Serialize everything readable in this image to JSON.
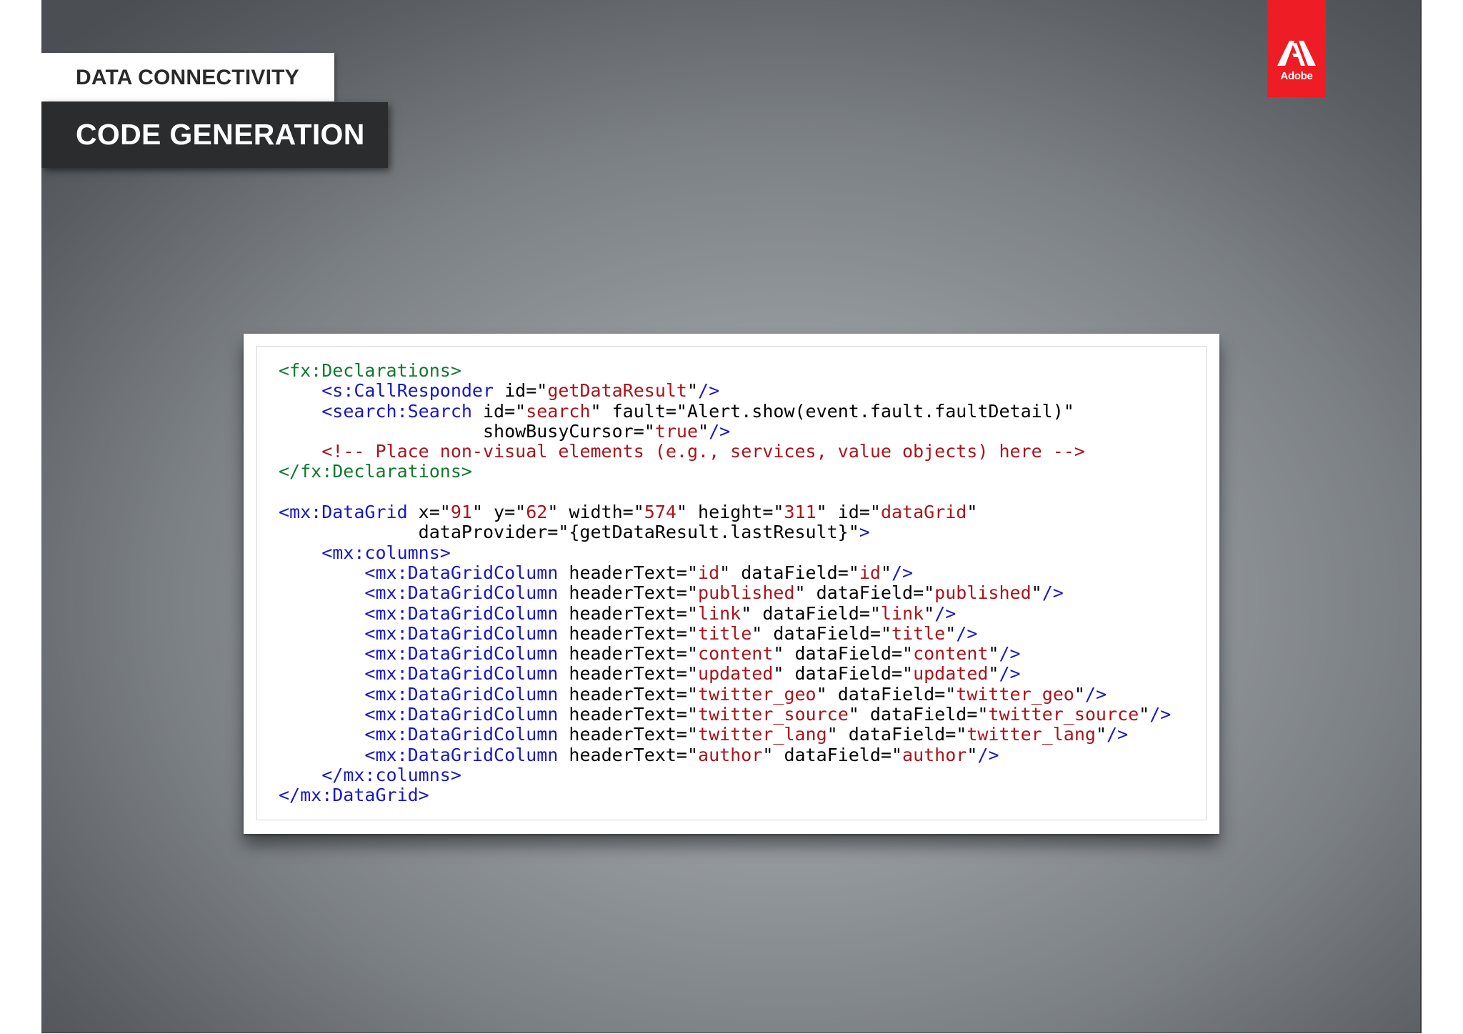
{
  "slide": {
    "section_label": "DATA CONNECTIVITY",
    "title": "CODE GENERATION",
    "logo_text": "Adobe"
  },
  "colors": {
    "tag_green": "#12792e",
    "tag_blue": "#1818c4",
    "string_red": "#a8151b",
    "adobe_red": "#ee1c24",
    "title_bar": "#2b2c2e"
  },
  "code": {
    "lines": [
      [
        {
          "t": "<fx:Declarations>",
          "c": "green"
        }
      ],
      [
        {
          "t": "    ",
          "c": "black"
        },
        {
          "t": "<s:CallResponder",
          "c": "blue"
        },
        {
          "t": " id=\"",
          "c": "black"
        },
        {
          "t": "getDataResult",
          "c": "red"
        },
        {
          "t": "\"",
          "c": "black"
        },
        {
          "t": "/>",
          "c": "blue"
        }
      ],
      [
        {
          "t": "    ",
          "c": "black"
        },
        {
          "t": "<search:Search",
          "c": "blue"
        },
        {
          "t": " id=\"",
          "c": "black"
        },
        {
          "t": "search",
          "c": "red"
        },
        {
          "t": "\" fault=\"Alert.show(event.fault.faultDetail)\"",
          "c": "black"
        }
      ],
      [
        {
          "t": "                   showBusyCursor=\"",
          "c": "black"
        },
        {
          "t": "true",
          "c": "red"
        },
        {
          "t": "\"",
          "c": "black"
        },
        {
          "t": "/>",
          "c": "blue"
        }
      ],
      [
        {
          "t": "    ",
          "c": "black"
        },
        {
          "t": "<!-- Place non-visual elements (e.g., services, value objects) here -->",
          "c": "comment"
        }
      ],
      [
        {
          "t": "</fx:Declarations>",
          "c": "green"
        }
      ],
      [
        {
          "t": "",
          "c": "black"
        }
      ],
      [
        {
          "t": "<mx:DataGrid",
          "c": "blue"
        },
        {
          "t": " x=\"",
          "c": "black"
        },
        {
          "t": "91",
          "c": "red"
        },
        {
          "t": "\" y=\"",
          "c": "black"
        },
        {
          "t": "62",
          "c": "red"
        },
        {
          "t": "\" width=\"",
          "c": "black"
        },
        {
          "t": "574",
          "c": "red"
        },
        {
          "t": "\" height=\"",
          "c": "black"
        },
        {
          "t": "311",
          "c": "red"
        },
        {
          "t": "\" id=\"",
          "c": "black"
        },
        {
          "t": "dataGrid",
          "c": "red"
        },
        {
          "t": "\"",
          "c": "black"
        }
      ],
      [
        {
          "t": "             dataProvider=\"{getDataResult.lastResult}\"",
          "c": "black"
        },
        {
          "t": ">",
          "c": "blue"
        }
      ],
      [
        {
          "t": "    ",
          "c": "black"
        },
        {
          "t": "<mx:columns>",
          "c": "blue"
        }
      ],
      [
        {
          "t": "        ",
          "c": "black"
        },
        {
          "t": "<mx:DataGridColumn",
          "c": "blue"
        },
        {
          "t": " headerText=\"",
          "c": "black"
        },
        {
          "t": "id",
          "c": "red"
        },
        {
          "t": "\" dataField=\"",
          "c": "black"
        },
        {
          "t": "id",
          "c": "red"
        },
        {
          "t": "\"",
          "c": "black"
        },
        {
          "t": "/>",
          "c": "blue"
        }
      ],
      [
        {
          "t": "        ",
          "c": "black"
        },
        {
          "t": "<mx:DataGridColumn",
          "c": "blue"
        },
        {
          "t": " headerText=\"",
          "c": "black"
        },
        {
          "t": "published",
          "c": "red"
        },
        {
          "t": "\" dataField=\"",
          "c": "black"
        },
        {
          "t": "published",
          "c": "red"
        },
        {
          "t": "\"",
          "c": "black"
        },
        {
          "t": "/>",
          "c": "blue"
        }
      ],
      [
        {
          "t": "        ",
          "c": "black"
        },
        {
          "t": "<mx:DataGridColumn",
          "c": "blue"
        },
        {
          "t": " headerText=\"",
          "c": "black"
        },
        {
          "t": "link",
          "c": "red"
        },
        {
          "t": "\" dataField=\"",
          "c": "black"
        },
        {
          "t": "link",
          "c": "red"
        },
        {
          "t": "\"",
          "c": "black"
        },
        {
          "t": "/>",
          "c": "blue"
        }
      ],
      [
        {
          "t": "        ",
          "c": "black"
        },
        {
          "t": "<mx:DataGridColumn",
          "c": "blue"
        },
        {
          "t": " headerText=\"",
          "c": "black"
        },
        {
          "t": "title",
          "c": "red"
        },
        {
          "t": "\" dataField=\"",
          "c": "black"
        },
        {
          "t": "title",
          "c": "red"
        },
        {
          "t": "\"",
          "c": "black"
        },
        {
          "t": "/>",
          "c": "blue"
        }
      ],
      [
        {
          "t": "        ",
          "c": "black"
        },
        {
          "t": "<mx:DataGridColumn",
          "c": "blue"
        },
        {
          "t": " headerText=\"",
          "c": "black"
        },
        {
          "t": "content",
          "c": "red"
        },
        {
          "t": "\" dataField=\"",
          "c": "black"
        },
        {
          "t": "content",
          "c": "red"
        },
        {
          "t": "\"",
          "c": "black"
        },
        {
          "t": "/>",
          "c": "blue"
        }
      ],
      [
        {
          "t": "        ",
          "c": "black"
        },
        {
          "t": "<mx:DataGridColumn",
          "c": "blue"
        },
        {
          "t": " headerText=\"",
          "c": "black"
        },
        {
          "t": "updated",
          "c": "red"
        },
        {
          "t": "\" dataField=\"",
          "c": "black"
        },
        {
          "t": "updated",
          "c": "red"
        },
        {
          "t": "\"",
          "c": "black"
        },
        {
          "t": "/>",
          "c": "blue"
        }
      ],
      [
        {
          "t": "        ",
          "c": "black"
        },
        {
          "t": "<mx:DataGridColumn",
          "c": "blue"
        },
        {
          "t": " headerText=\"",
          "c": "black"
        },
        {
          "t": "twitter_geo",
          "c": "red"
        },
        {
          "t": "\" dataField=\"",
          "c": "black"
        },
        {
          "t": "twitter_geo",
          "c": "red"
        },
        {
          "t": "\"",
          "c": "black"
        },
        {
          "t": "/>",
          "c": "blue"
        }
      ],
      [
        {
          "t": "        ",
          "c": "black"
        },
        {
          "t": "<mx:DataGridColumn",
          "c": "blue"
        },
        {
          "t": " headerText=\"",
          "c": "black"
        },
        {
          "t": "twitter_source",
          "c": "red"
        },
        {
          "t": "\" dataField=\"",
          "c": "black"
        },
        {
          "t": "twitter_source",
          "c": "red"
        },
        {
          "t": "\"",
          "c": "black"
        },
        {
          "t": "/>",
          "c": "blue"
        }
      ],
      [
        {
          "t": "        ",
          "c": "black"
        },
        {
          "t": "<mx:DataGridColumn",
          "c": "blue"
        },
        {
          "t": " headerText=\"",
          "c": "black"
        },
        {
          "t": "twitter_lang",
          "c": "red"
        },
        {
          "t": "\" dataField=\"",
          "c": "black"
        },
        {
          "t": "twitter_lang",
          "c": "red"
        },
        {
          "t": "\"",
          "c": "black"
        },
        {
          "t": "/>",
          "c": "blue"
        }
      ],
      [
        {
          "t": "        ",
          "c": "black"
        },
        {
          "t": "<mx:DataGridColumn",
          "c": "blue"
        },
        {
          "t": " headerText=\"",
          "c": "black"
        },
        {
          "t": "author",
          "c": "red"
        },
        {
          "t": "\" dataField=\"",
          "c": "black"
        },
        {
          "t": "author",
          "c": "red"
        },
        {
          "t": "\"",
          "c": "black"
        },
        {
          "t": "/>",
          "c": "blue"
        }
      ],
      [
        {
          "t": "    ",
          "c": "black"
        },
        {
          "t": "</mx:columns>",
          "c": "blue"
        }
      ],
      [
        {
          "t": "</mx:DataGrid>",
          "c": "blue"
        }
      ]
    ]
  }
}
